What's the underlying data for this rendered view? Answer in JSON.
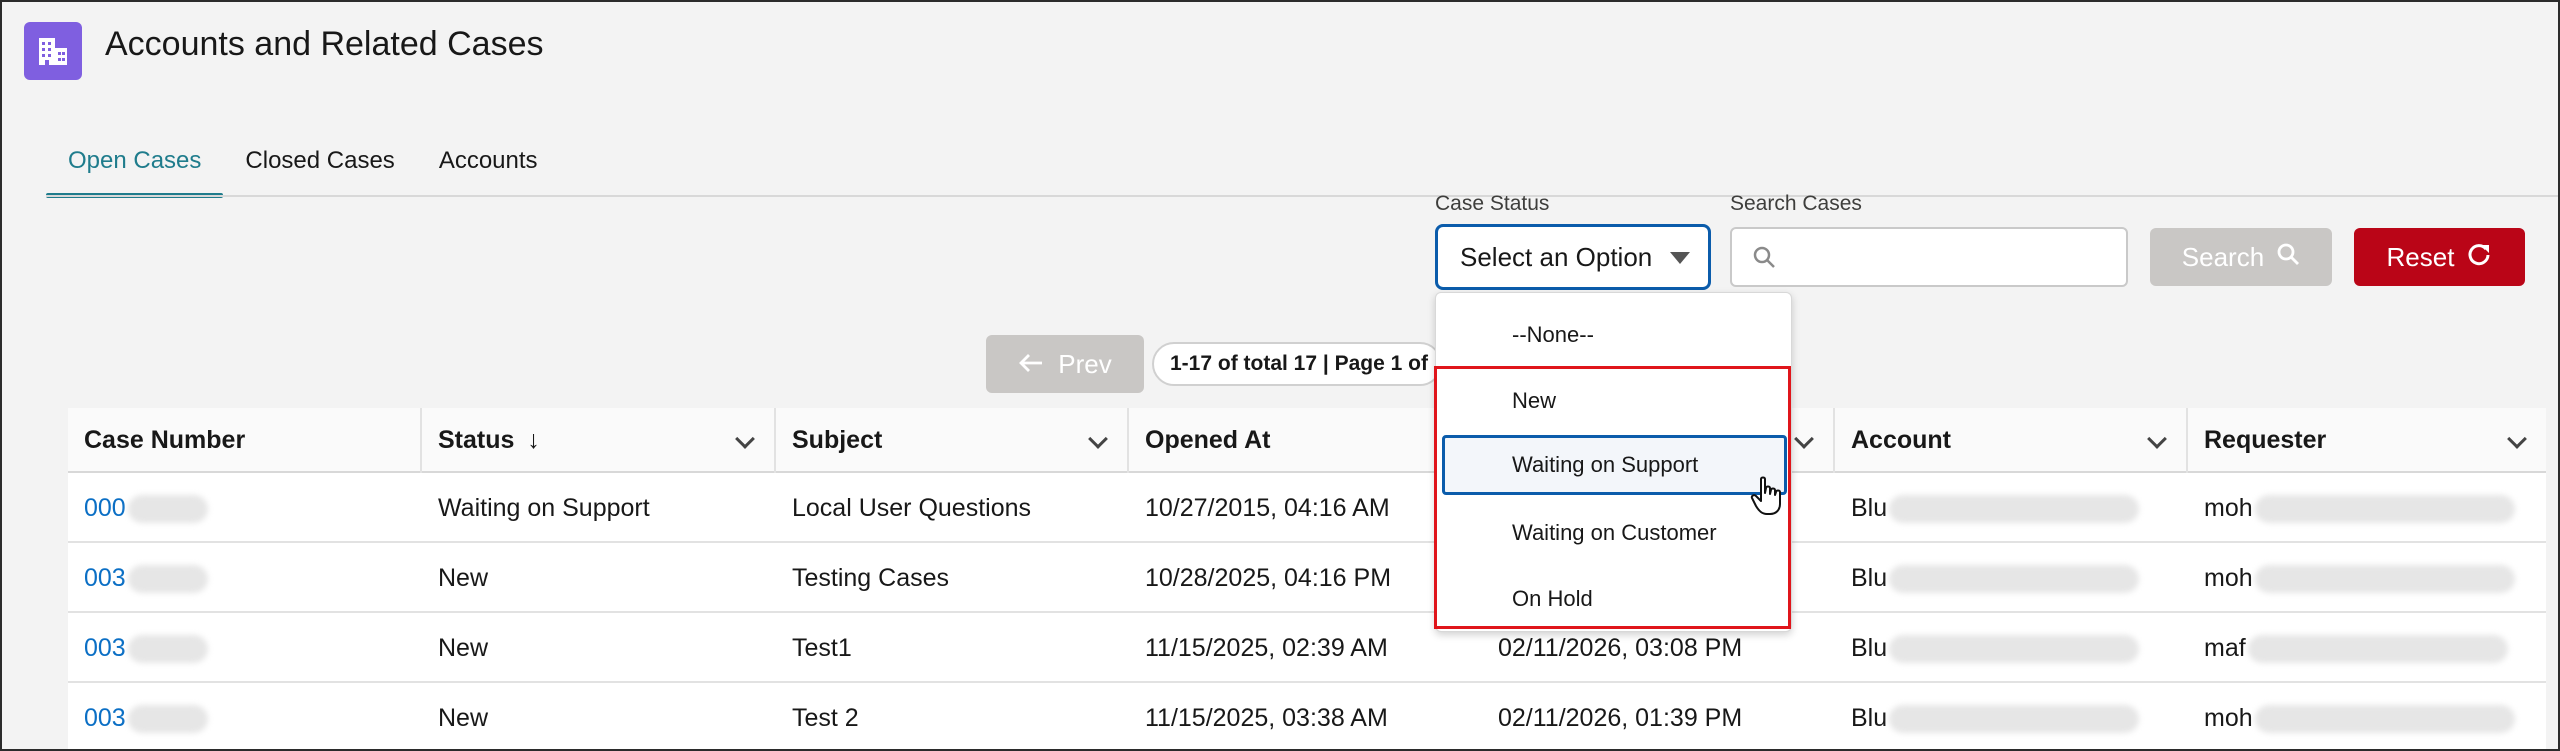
{
  "header": {
    "title": "Accounts and Related Cases",
    "icon": "building-icon",
    "icon_color": "#7f5fe0"
  },
  "tabs": [
    {
      "label": "Open Cases",
      "active": true
    },
    {
      "label": "Closed Cases",
      "active": false
    },
    {
      "label": "Accounts",
      "active": false
    }
  ],
  "filters": {
    "case_status_label": "Case Status",
    "case_status_value": "Select an Option",
    "search_label": "Search Cases",
    "search_placeholder": "",
    "search_button": "Search",
    "reset_button": "Reset"
  },
  "pagination": {
    "prev_label": "Prev",
    "info": "1-17 of total 17 | Page 1 of"
  },
  "dropdown": {
    "options": [
      "--None--",
      "New",
      "Waiting on Support",
      "Waiting on Customer",
      "On Hold"
    ],
    "highlighted": "Waiting on Support"
  },
  "table": {
    "columns": [
      "Case Number",
      "Status",
      "Subject",
      "Opened At",
      "",
      "Account",
      "Requester"
    ],
    "sort_indicator": "↓",
    "rows": [
      {
        "case_number": "000",
        "status": "Waiting on Support",
        "subject": "Local User Questions",
        "opened_at": "10/27/2015, 04:16 AM",
        "modified_at": "",
        "account": "Blu",
        "requester": "moh"
      },
      {
        "case_number": "003",
        "status": "New",
        "subject": "Testing Cases",
        "opened_at": "10/28/2025, 04:16 PM",
        "modified_at": "",
        "account": "Blu",
        "requester": "moh"
      },
      {
        "case_number": "003",
        "status": "New",
        "subject": "Test1",
        "opened_at": "11/15/2025, 02:39 AM",
        "modified_at": "02/11/2026, 03:08 PM",
        "account": "Blu",
        "requester": "maf"
      },
      {
        "case_number": "003",
        "status": "New",
        "subject": "Test 2",
        "opened_at": "11/15/2025, 03:38 AM",
        "modified_at": "02/11/2026, 01:39 PM",
        "account": "Blu",
        "requester": "moh"
      }
    ]
  },
  "colors": {
    "accent": "#1f7c8c",
    "link": "#0b6fc5",
    "reset": "#ba0517",
    "focus": "#0b5cab",
    "annotation": "#e0151b"
  }
}
